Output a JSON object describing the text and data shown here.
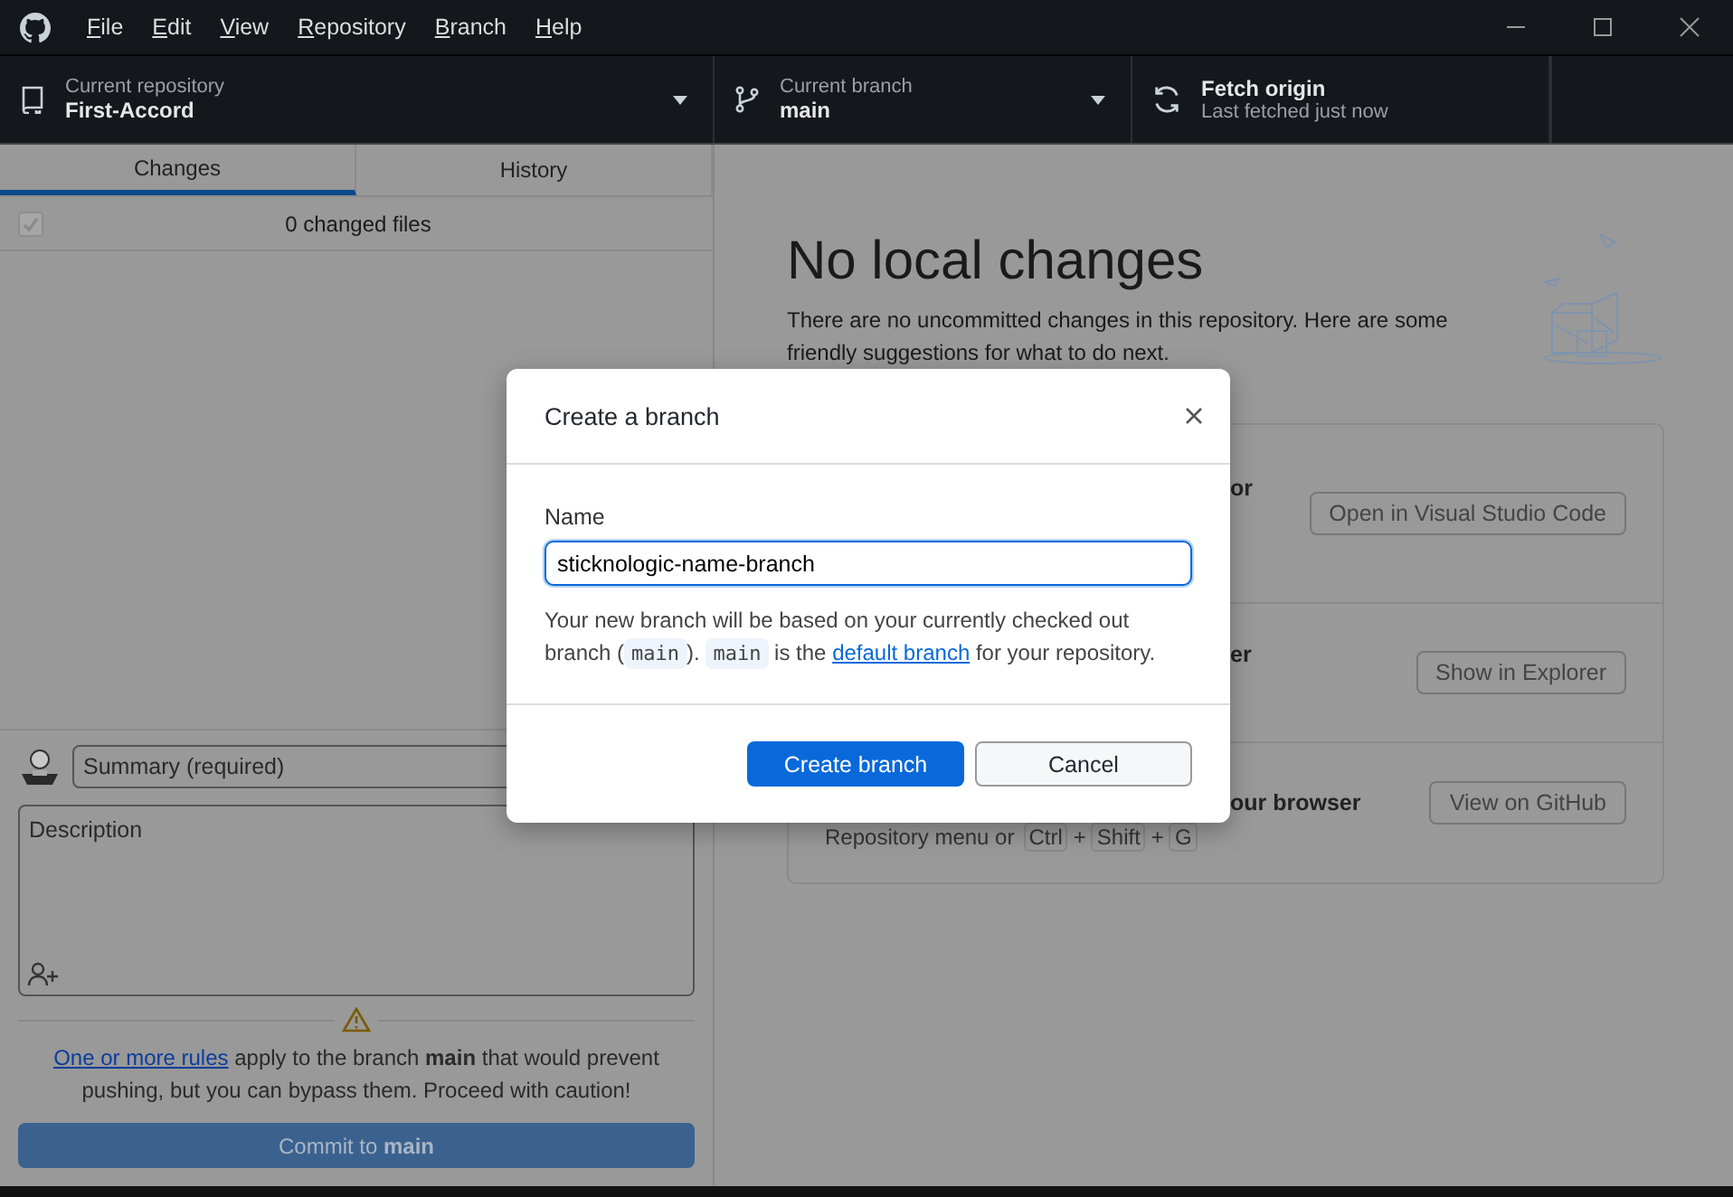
{
  "menu": [
    {
      "label": "File"
    },
    {
      "label": "Edit"
    },
    {
      "label": "View"
    },
    {
      "label": "Repository"
    },
    {
      "label": "Branch"
    },
    {
      "label": "Help"
    }
  ],
  "toolbar": [
    {
      "kind": "repository",
      "label": "Current repository",
      "value": "First-Accord"
    },
    {
      "kind": "branch",
      "label": "Current branch",
      "value": "main"
    },
    {
      "kind": "fetch",
      "label": "Fetch origin",
      "value": "Last fetched just now"
    }
  ],
  "tabs": [
    {
      "label": "Changes",
      "selected": true
    },
    {
      "label": "History",
      "selected": false
    }
  ],
  "changes": {
    "checked": true,
    "summary": "0 changed files"
  },
  "commit": {
    "summary_placeholder": "Summary (required)",
    "description_placeholder": "Description",
    "warning_link": "One or more rules",
    "warning_text": "apply to the branch **main** that would prevent pushing, but you can bypass them. Proceed with caution!",
    "button": "Commit to **main**",
    "disabled": true
  },
  "main": {
    "heading": "No local changes",
    "description": "There are no uncommitted changes in this repository. Here are some friendly suggestions for what to do next.",
    "cards": [
      {
        "title": "or",
        "button": "Open in Visual Studio Code"
      },
      {
        "title": "er",
        "button": "Show in Explorer"
      },
      {
        "title": "our browser",
        "button": "View on GitHub",
        "hint": "Repository menu or",
        "keys": [
          {
            "kind": "key",
            "text": "Ctrl"
          },
          {
            "kind": "plus",
            "text": "+"
          },
          {
            "kind": "key",
            "text": "Shift"
          },
          {
            "kind": "plus",
            "text": "+"
          },
          {
            "kind": "key",
            "text": "G"
          }
        ]
      }
    ]
  },
  "dialog": {
    "title": "Create a branch",
    "name_label": "Name",
    "name_value": "sticknologic-name-branch",
    "help": [
      {
        "kind": "text",
        "text": "Your new branch will be based on your currently checked out branch ("
      },
      {
        "kind": "code",
        "text": "main"
      },
      {
        "kind": "text",
        "text": "). "
      },
      {
        "kind": "code",
        "text": "main"
      },
      {
        "kind": "text",
        "text": " is the "
      },
      {
        "kind": "link",
        "text": "default branch"
      },
      {
        "kind": "text",
        "text": " for your repository."
      }
    ],
    "buttons": [
      {
        "kind": "primary",
        "label": "Create branch"
      },
      {
        "kind": "secondary",
        "label": "Cancel"
      }
    ]
  }
}
